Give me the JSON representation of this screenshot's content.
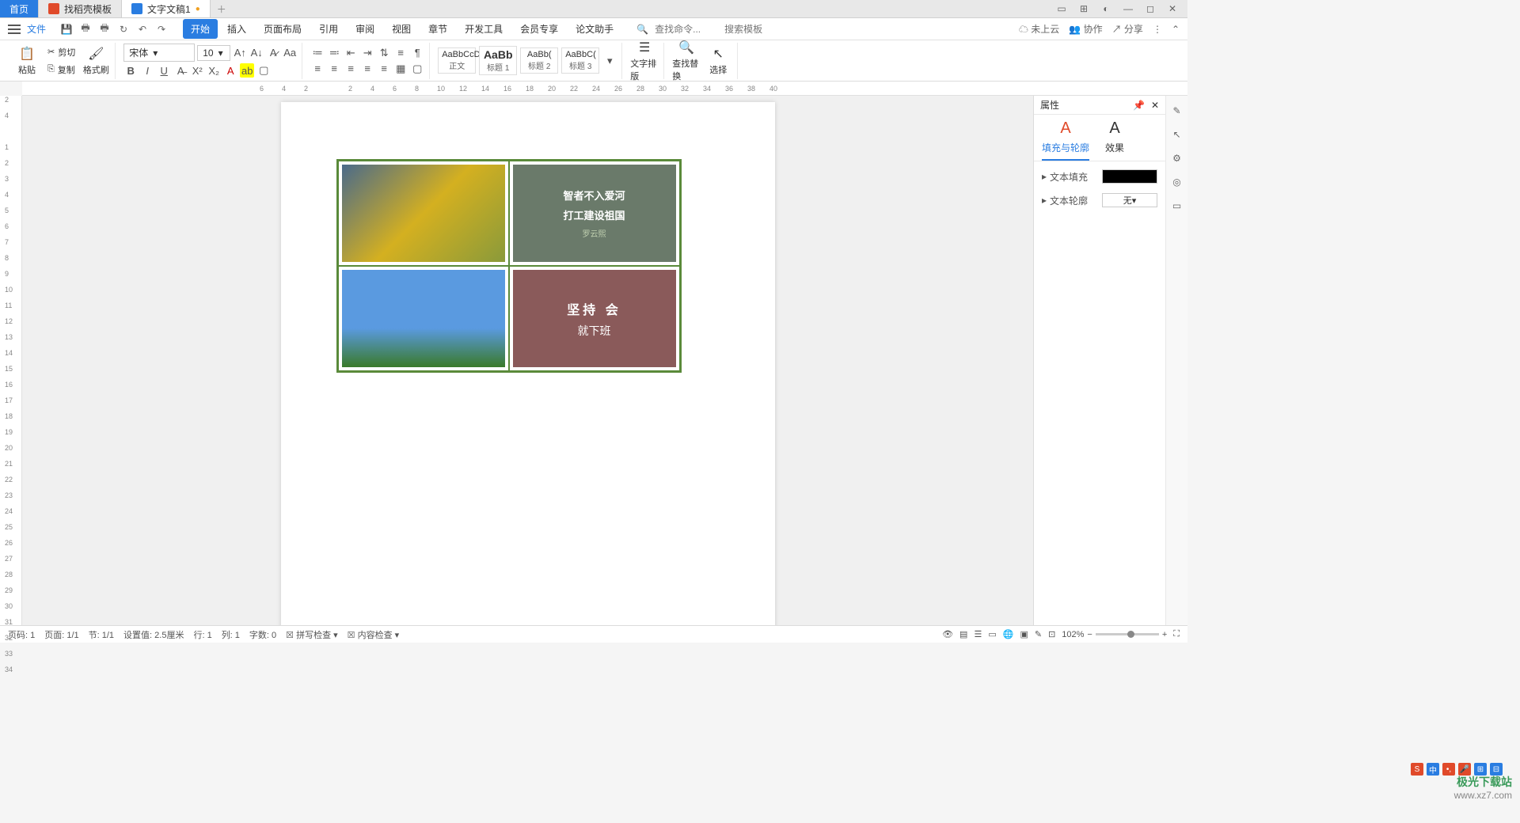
{
  "tabs": {
    "home": "首页",
    "template": "找稻壳模板",
    "doc": "文字文稿1"
  },
  "menu": {
    "file": "文件",
    "tabs": [
      "开始",
      "插入",
      "页面布局",
      "引用",
      "审阅",
      "视图",
      "章节",
      "开发工具",
      "会员专享",
      "论文助手"
    ],
    "search_cmd": "查找命令...",
    "search_tpl": "搜索模板",
    "cloud": "未上云",
    "coop": "协作",
    "share": "分享"
  },
  "ribbon": {
    "paste": "粘贴",
    "cut": "剪切",
    "copy": "复制",
    "format_painter": "格式刷",
    "font_name": "宋体",
    "font_size": "10",
    "styles": [
      {
        "preview": "AaBbCcD",
        "label": "正文"
      },
      {
        "preview": "AaBb",
        "label": "标题 1"
      },
      {
        "preview": "AaBb(",
        "label": "标题 2"
      },
      {
        "preview": "AaBbC(",
        "label": "标题 3"
      }
    ],
    "text_layout": "文字排版",
    "find_replace": "查找替换",
    "select": "选择"
  },
  "panel": {
    "title": "属性",
    "tab_fill": "填充与轮廓",
    "tab_effect": "效果",
    "text_fill": "文本填充",
    "text_outline": "文本轮廓",
    "none": "无"
  },
  "doc_content": {
    "cell2_line1": "智者不入爱河",
    "cell2_line2": "打工建设祖国",
    "cell2_caption": "罗云熙",
    "cell4_line1": "坚持    会",
    "cell4_line2": "就下班"
  },
  "status": {
    "page_code": "页码: 1",
    "page": "页面: 1/1",
    "section": "节: 1/1",
    "indent": "设置值: 2.5厘米",
    "line": "行: 1",
    "col": "列: 1",
    "chars": "字数: 0",
    "spellcheck": "拼写检查",
    "content_check": "内容检查",
    "zoom": "102%"
  },
  "ruler_h": [
    "6",
    "4",
    "2",
    "",
    "2",
    "4",
    "6",
    "8",
    "10",
    "12",
    "14",
    "16",
    "18",
    "20",
    "22",
    "24",
    "26",
    "28",
    "30",
    "32",
    "34",
    "36",
    "38",
    "40"
  ],
  "ruler_v": [
    "2",
    "4",
    "",
    "1",
    "2",
    "3",
    "4",
    "5",
    "6",
    "7",
    "8",
    "9",
    "10",
    "11",
    "12",
    "13",
    "14",
    "15",
    "16",
    "17",
    "18",
    "19",
    "20",
    "21",
    "22",
    "23",
    "24",
    "25",
    "26",
    "27",
    "28",
    "29",
    "30",
    "31",
    "32",
    "33",
    "34"
  ],
  "watermark": {
    "t1": "极光下载站",
    "t2": "www.xz7.com"
  }
}
